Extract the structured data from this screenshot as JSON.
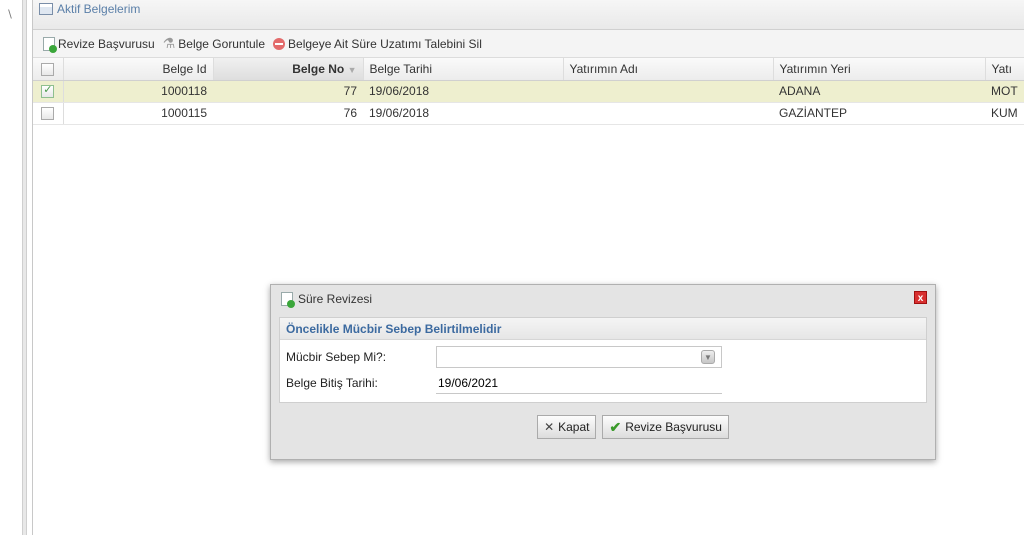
{
  "panel": {
    "title": "Aktif Belgelerim"
  },
  "toolbar": {
    "revize_label": "Revize Başvurusu",
    "goruntule_label": "Belge Goruntule",
    "sil_label": "Belgeye Ait Süre Uzatımı Talebini Sil"
  },
  "grid": {
    "columns": [
      "Belge Id",
      "Belge No",
      "Belge Tarihi",
      "Yatırımın Adı",
      "Yatırımın Yeri",
      "Yatı"
    ],
    "rows": [
      {
        "checked": true,
        "belge_id": "1000118",
        "belge_no": "77",
        "belge_tarihi": "19/06/2018",
        "yatirimin_adi": "",
        "yatirimin_yeri": "ADANA",
        "extra": "MOT"
      },
      {
        "checked": false,
        "belge_id": "1000115",
        "belge_no": "76",
        "belge_tarihi": "19/06/2018",
        "yatirimin_adi": "",
        "yatirimin_yeri": "GAZİANTEP",
        "extra": "KUM"
      }
    ]
  },
  "dialog": {
    "title": "Süre Revizesi",
    "close_label": "x",
    "subheading": "Öncelikle Mücbir Sebep Belirtilmelidir",
    "mucbir_label": "Mücbir Sebep Mi?:",
    "mucbir_value": "",
    "bitis_label": "Belge Bitiş Tarihi:",
    "bitis_value": "19/06/2021",
    "kapat_label": "Kapat",
    "revize_label": "Revize Başvurusu"
  }
}
